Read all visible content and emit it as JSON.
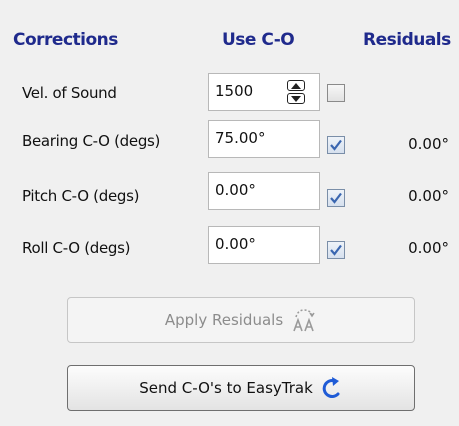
{
  "headers": {
    "corrections": "Corrections",
    "use_co": "Use C-O",
    "residuals": "Residuals"
  },
  "rows": [
    {
      "label": "Vel. of Sound",
      "value": "1500",
      "use_checked": false,
      "residual": ""
    },
    {
      "label": "Bearing C-O (degs)",
      "value": "75.00°",
      "use_checked": true,
      "residual": "0.00°"
    },
    {
      "label": "Pitch C-O (degs)",
      "value": "0.00°",
      "use_checked": true,
      "residual": "0.00°"
    },
    {
      "label": "Roll C-O (degs)",
      "value": "0.00°",
      "use_checked": true,
      "residual": "0.00°"
    }
  ],
  "buttons": {
    "apply_residuals": "Apply Residuals",
    "apply_residuals_enabled": false,
    "send_co": "Send C-O's to EasyTrak"
  },
  "icons": {
    "apply_residuals_icon": "text-transform-icon",
    "send_co_icon": "refresh-arrow-icon",
    "spinner_up": "arrow-up-icon",
    "spinner_down": "arrow-down-icon",
    "checkmark": "checkmark-icon"
  },
  "colors": {
    "header_text": "#1f2a8c",
    "checkbox_checked": "#3a66b0",
    "send_icon": "#1f5bd6"
  }
}
